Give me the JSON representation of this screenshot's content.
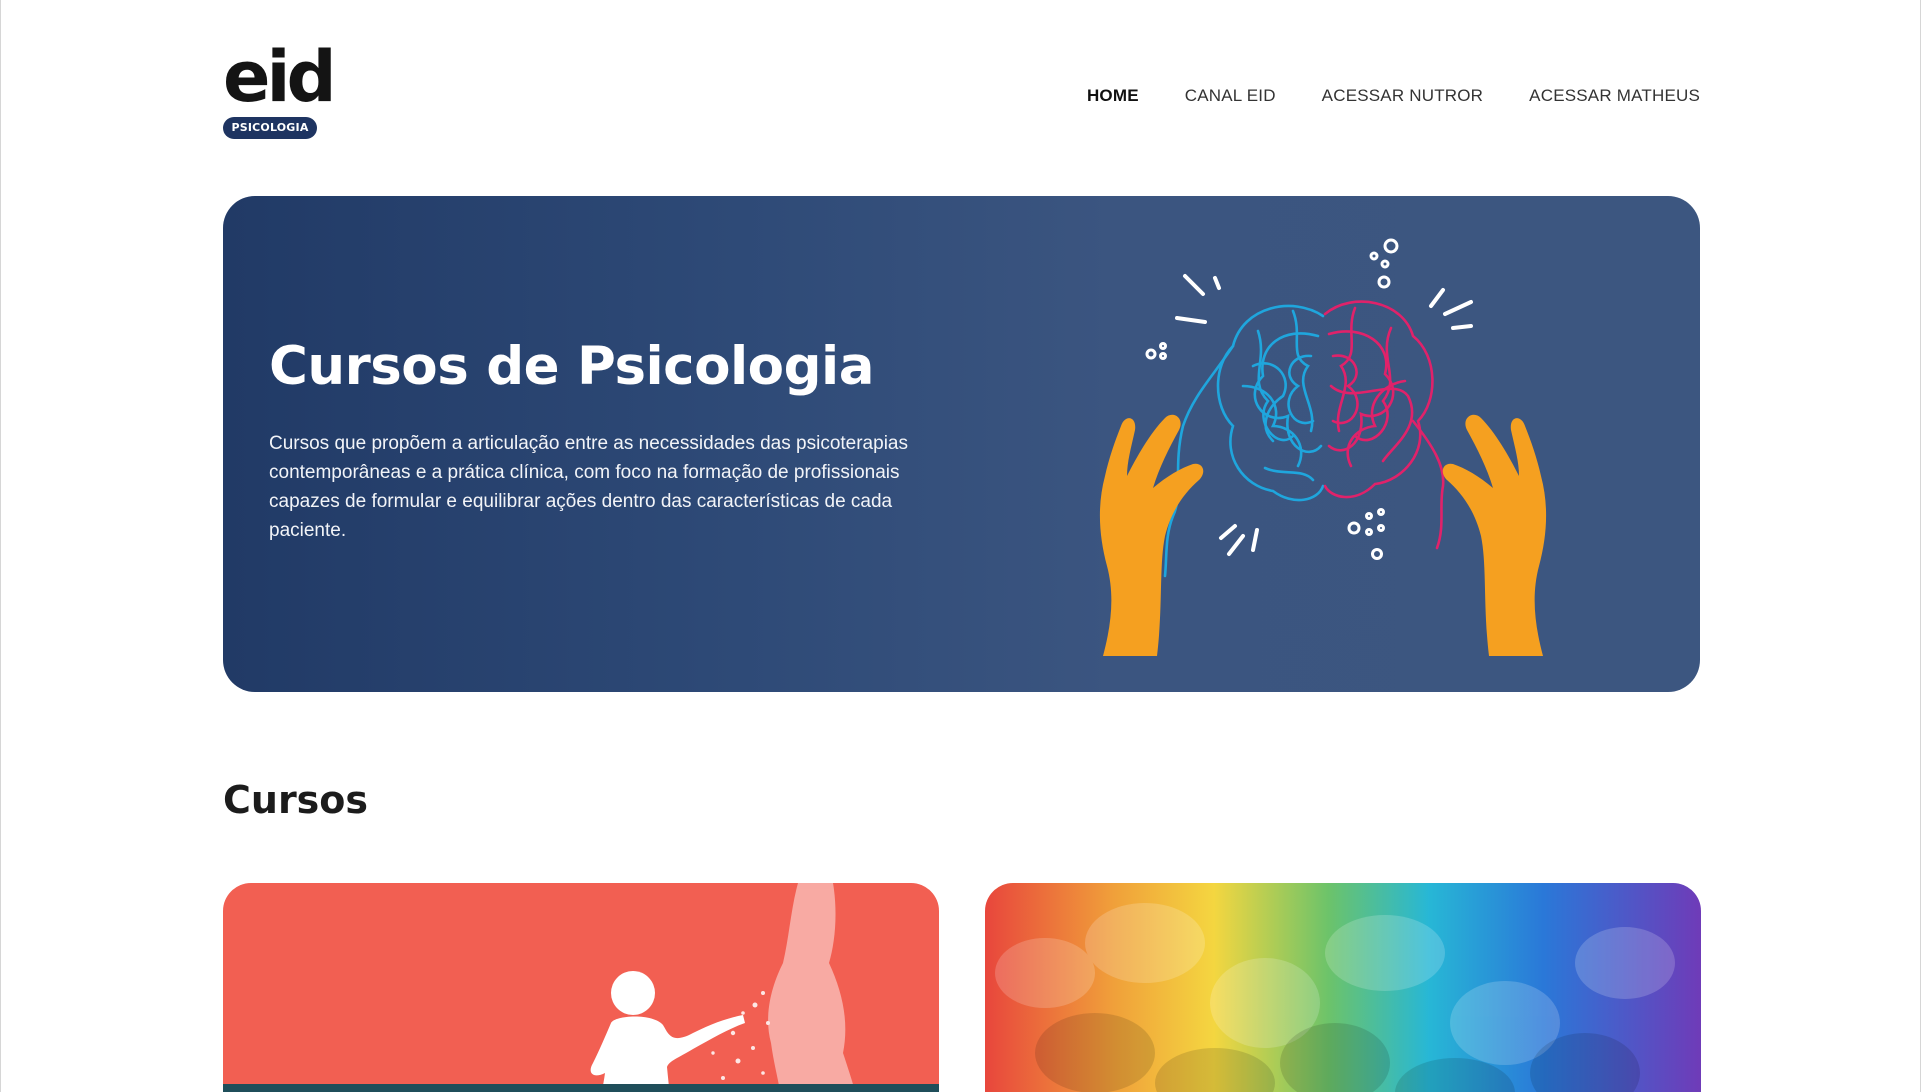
{
  "logo": {
    "wordmark": "eid",
    "tag": "PSICOLOGIA"
  },
  "nav": {
    "items": [
      {
        "label": "HOME",
        "active": true
      },
      {
        "label": "CANAL EID",
        "active": false
      },
      {
        "label": "ACESSAR NUTROR",
        "active": false
      },
      {
        "label": "ACESSAR MATHEUS",
        "active": false
      }
    ]
  },
  "hero": {
    "title": "Cursos de Psicologia",
    "description": "Cursos que propõem a articulação entre as necessidades das psicoterapias contemporâneas e a prática clínica, com foco na formação de profissionais capazes de formular e equilibrar ações dentro das características de cada paciente."
  },
  "courses": {
    "title": "Cursos"
  },
  "colors": {
    "hero_bg_start": "#213a66",
    "hero_bg_end": "#3c5680",
    "brand_navy": "#1e3461",
    "card_coral": "#f25f52",
    "hand_orange": "#f5a020",
    "brain_blue": "#1fa6dd",
    "brain_pink": "#e0226a"
  }
}
